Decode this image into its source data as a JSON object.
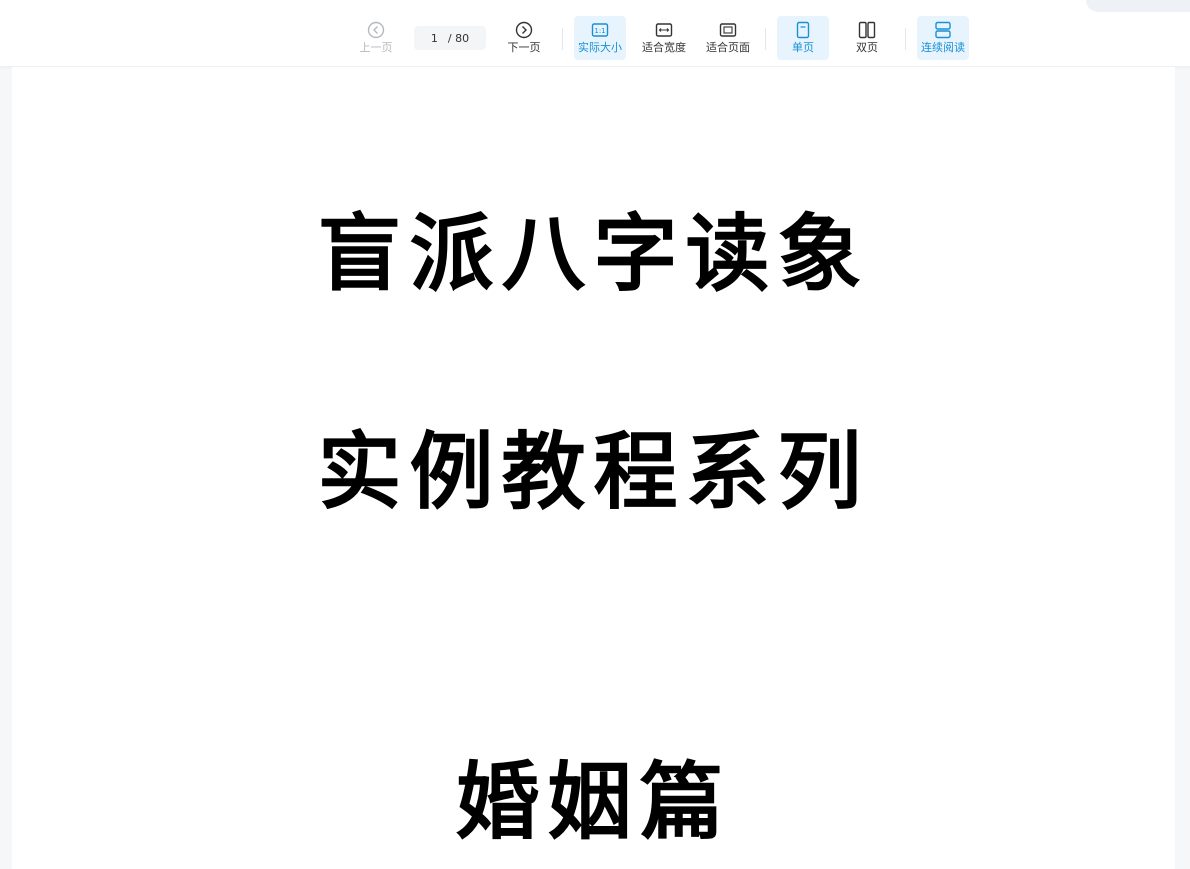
{
  "toolbar": {
    "prev_label": "上一页",
    "next_label": "下一页",
    "page_current": "1",
    "page_total": "/ 80",
    "actual_size_label": "实际大小",
    "actual_size_icon_text": "1:1",
    "fit_width_label": "适合宽度",
    "fit_page_label": "适合页面",
    "single_page_label": "单页",
    "double_page_label": "双页",
    "continuous_label": "连续阅读"
  },
  "document": {
    "title_line1": "盲派八字读象",
    "title_line2": "实例教程系列",
    "title_line3": "婚姻篇"
  },
  "colors": {
    "accent": "#1890d6",
    "active_bg": "#e8f4fd",
    "disabled": "#b5b9be"
  }
}
